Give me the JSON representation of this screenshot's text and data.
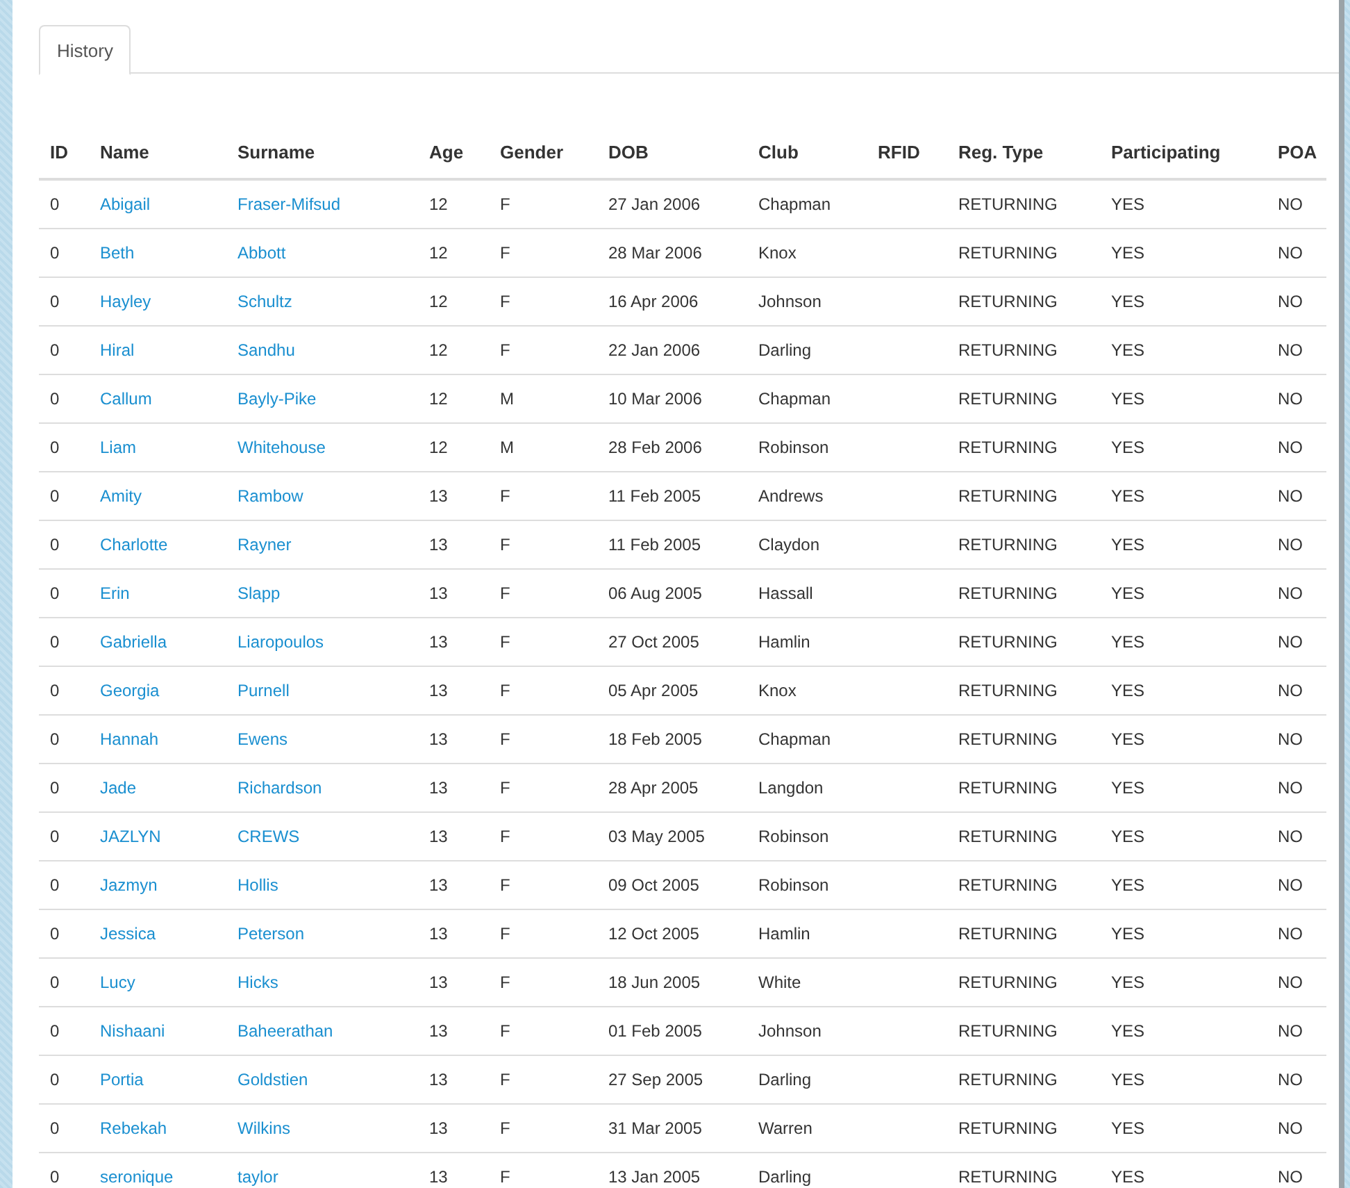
{
  "tabs": [
    {
      "label": "History",
      "selected": true
    }
  ],
  "table": {
    "columns": [
      "ID",
      "Name",
      "Surname",
      "Age",
      "Gender",
      "DOB",
      "Club",
      "RFID",
      "Reg. Type",
      "Participating",
      "POA"
    ],
    "rows": [
      {
        "id": "0",
        "name": "Abigail",
        "surname": "Fraser-Mifsud",
        "age": "12",
        "gender": "F",
        "dob": "27 Jan 2006",
        "club": "Chapman",
        "reg_type": "RETURNING",
        "participating": "YES",
        "poa": "NO"
      },
      {
        "id": "0",
        "name": "Beth",
        "surname": "Abbott",
        "age": "12",
        "gender": "F",
        "dob": "28 Mar 2006",
        "club": "Knox",
        "reg_type": "RETURNING",
        "participating": "YES",
        "poa": "NO"
      },
      {
        "id": "0",
        "name": "Hayley",
        "surname": "Schultz",
        "age": "12",
        "gender": "F",
        "dob": "16 Apr 2006",
        "club": "Johnson",
        "reg_type": "RETURNING",
        "participating": "YES",
        "poa": "NO"
      },
      {
        "id": "0",
        "name": "Hiral",
        "surname": "Sandhu",
        "age": "12",
        "gender": "F",
        "dob": "22 Jan 2006",
        "club": "Darling",
        "reg_type": "RETURNING",
        "participating": "YES",
        "poa": "NO"
      },
      {
        "id": "0",
        "name": "Callum",
        "surname": "Bayly-Pike",
        "age": "12",
        "gender": "M",
        "dob": "10 Mar 2006",
        "club": "Chapman",
        "reg_type": "RETURNING",
        "participating": "YES",
        "poa": "NO"
      },
      {
        "id": "0",
        "name": "Liam",
        "surname": "Whitehouse",
        "age": "12",
        "gender": "M",
        "dob": "28 Feb 2006",
        "club": "Robinson",
        "reg_type": "RETURNING",
        "participating": "YES",
        "poa": "NO"
      },
      {
        "id": "0",
        "name": "Amity",
        "surname": "Rambow",
        "age": "13",
        "gender": "F",
        "dob": "11 Feb 2005",
        "club": "Andrews",
        "reg_type": "RETURNING",
        "participating": "YES",
        "poa": "NO"
      },
      {
        "id": "0",
        "name": "Charlotte",
        "surname": "Rayner",
        "age": "13",
        "gender": "F",
        "dob": "11 Feb 2005",
        "club": "Claydon",
        "reg_type": "RETURNING",
        "participating": "YES",
        "poa": "NO"
      },
      {
        "id": "0",
        "name": "Erin",
        "surname": "Slapp",
        "age": "13",
        "gender": "F",
        "dob": "06 Aug 2005",
        "club": "Hassall",
        "reg_type": "RETURNING",
        "participating": "YES",
        "poa": "NO"
      },
      {
        "id": "0",
        "name": "Gabriella",
        "surname": "Liaropoulos",
        "age": "13",
        "gender": "F",
        "dob": "27 Oct 2005",
        "club": "Hamlin",
        "reg_type": "RETURNING",
        "participating": "YES",
        "poa": "NO"
      },
      {
        "id": "0",
        "name": "Georgia",
        "surname": "Purnell",
        "age": "13",
        "gender": "F",
        "dob": "05 Apr 2005",
        "club": "Knox",
        "reg_type": "RETURNING",
        "participating": "YES",
        "poa": "NO"
      },
      {
        "id": "0",
        "name": "Hannah",
        "surname": "Ewens",
        "age": "13",
        "gender": "F",
        "dob": "18 Feb 2005",
        "club": "Chapman",
        "reg_type": "RETURNING",
        "participating": "YES",
        "poa": "NO"
      },
      {
        "id": "0",
        "name": "Jade",
        "surname": "Richardson",
        "age": "13",
        "gender": "F",
        "dob": "28 Apr 2005",
        "club": "Langdon",
        "reg_type": "RETURNING",
        "participating": "YES",
        "poa": "NO"
      },
      {
        "id": "0",
        "name": "JAZLYN",
        "surname": "CREWS",
        "age": "13",
        "gender": "F",
        "dob": "03 May 2005",
        "club": "Robinson",
        "reg_type": "RETURNING",
        "participating": "YES",
        "poa": "NO"
      },
      {
        "id": "0",
        "name": "Jazmyn",
        "surname": "Hollis",
        "age": "13",
        "gender": "F",
        "dob": "09 Oct 2005",
        "club": "Robinson",
        "reg_type": "RETURNING",
        "participating": "YES",
        "poa": "NO"
      },
      {
        "id": "0",
        "name": "Jessica",
        "surname": "Peterson",
        "age": "13",
        "gender": "F",
        "dob": "12 Oct 2005",
        "club": "Hamlin",
        "reg_type": "RETURNING",
        "participating": "YES",
        "poa": "NO"
      },
      {
        "id": "0",
        "name": "Lucy",
        "surname": "Hicks",
        "age": "13",
        "gender": "F",
        "dob": "18 Jun 2005",
        "club": "White",
        "reg_type": "RETURNING",
        "participating": "YES",
        "poa": "NO"
      },
      {
        "id": "0",
        "name": "Nishaani",
        "surname": "Baheerathan",
        "age": "13",
        "gender": "F",
        "dob": "01 Feb 2005",
        "club": "Johnson",
        "reg_type": "RETURNING",
        "participating": "YES",
        "poa": "NO"
      },
      {
        "id": "0",
        "name": "Portia",
        "surname": "Goldstien",
        "age": "13",
        "gender": "F",
        "dob": "27 Sep 2005",
        "club": "Darling",
        "reg_type": "RETURNING",
        "participating": "YES",
        "poa": "NO"
      },
      {
        "id": "0",
        "name": "Rebekah",
        "surname": "Wilkins",
        "age": "13",
        "gender": "F",
        "dob": "31 Mar 2005",
        "club": "Warren",
        "reg_type": "RETURNING",
        "participating": "YES",
        "poa": "NO"
      },
      {
        "id": "0",
        "name": "seronique",
        "surname": "taylor",
        "age": "13",
        "gender": "F",
        "dob": "13 Jan 2005",
        "club": "Darling",
        "reg_type": "RETURNING",
        "participating": "YES",
        "poa": "NO"
      }
    ]
  }
}
